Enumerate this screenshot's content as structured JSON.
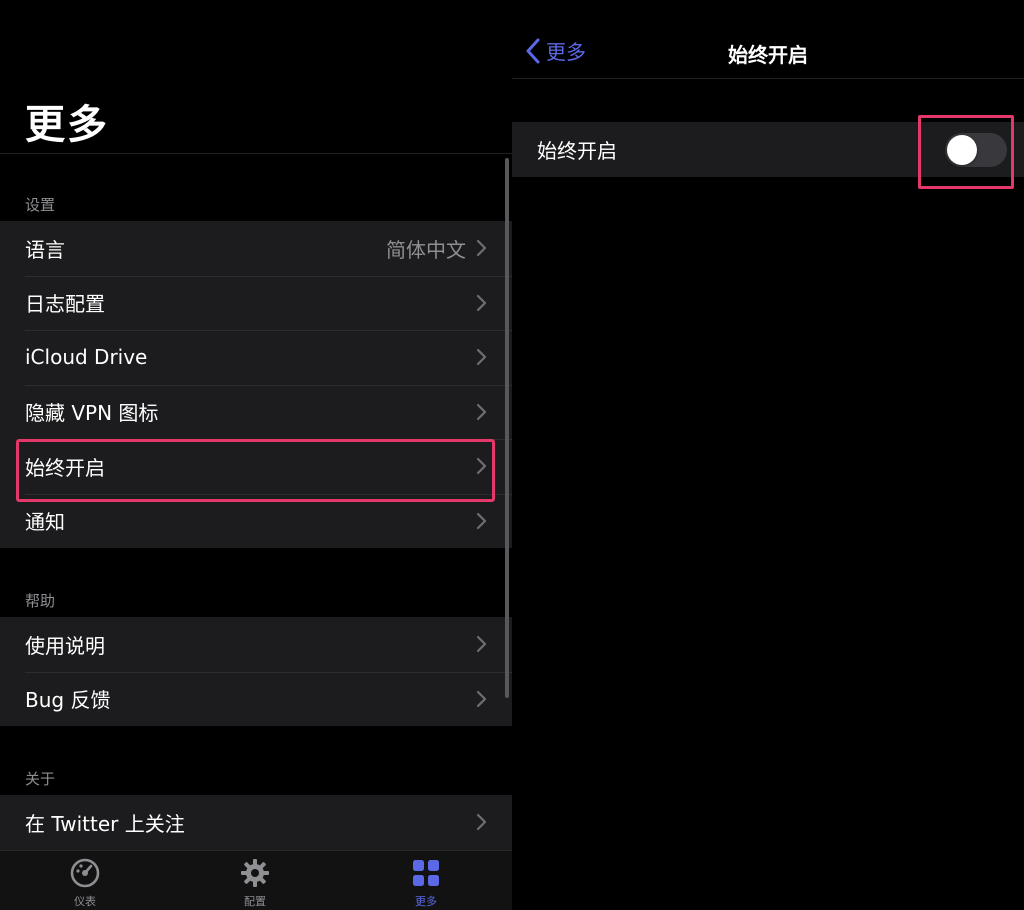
{
  "left": {
    "title": "更多",
    "sections": [
      {
        "header": "设置",
        "rows": [
          {
            "label": "语言",
            "value": "简体中文"
          },
          {
            "label": "日志配置"
          },
          {
            "label": "iCloud Drive"
          },
          {
            "label": "隐藏 VPN 图标"
          },
          {
            "label": "始终开启"
          },
          {
            "label": "通知"
          }
        ]
      },
      {
        "header": "帮助",
        "rows": [
          {
            "label": "使用说明"
          },
          {
            "label": "Bug 反馈"
          }
        ]
      },
      {
        "header": "关于",
        "rows": [
          {
            "label": "在 Twitter 上关注"
          }
        ]
      }
    ]
  },
  "tabbar": {
    "tabs": [
      {
        "label": "仪表",
        "icon": "dashboard-icon",
        "active": false
      },
      {
        "label": "配置",
        "icon": "gear-icon",
        "active": false
      },
      {
        "label": "更多",
        "icon": "grid-icon",
        "active": true
      }
    ]
  },
  "right": {
    "back_label": "更多",
    "nav_title": "始终开启",
    "row_label": "始终开启",
    "toggle_on": false
  },
  "colors": {
    "accent": "#5b69e6",
    "highlight": "#e4386a",
    "cell_bg": "#1c1c1e",
    "secondary_text": "#8e8e93"
  }
}
